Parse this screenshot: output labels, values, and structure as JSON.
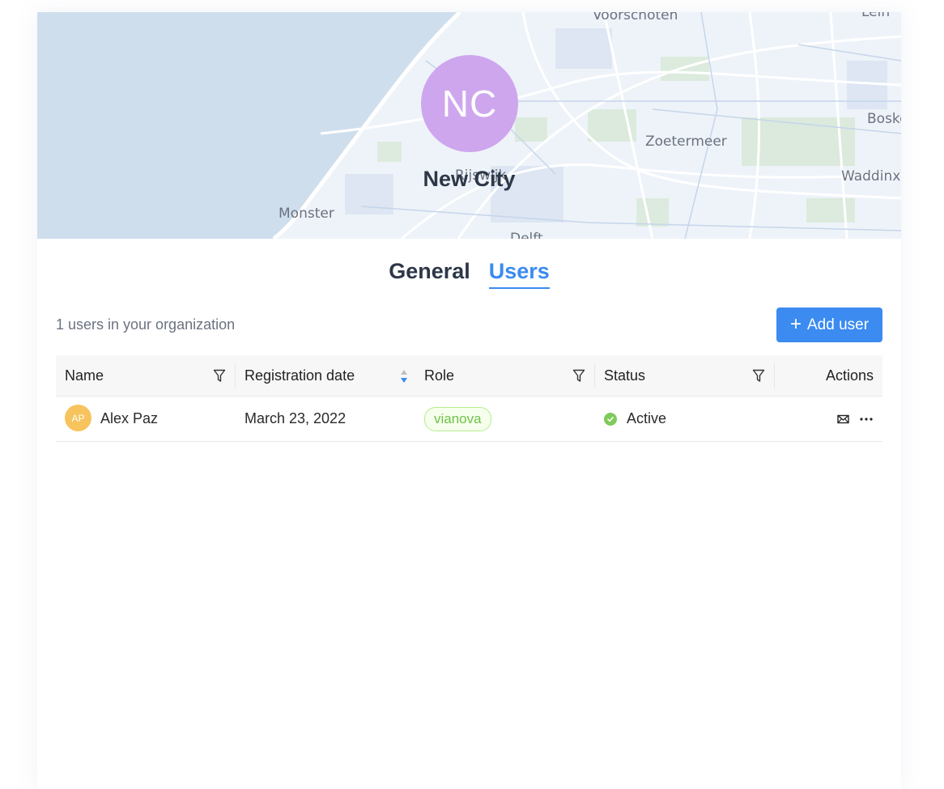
{
  "banner": {
    "initials": "NC",
    "org_name": "New City",
    "map_labels": {
      "top": "Voorschoten",
      "zoetermeer": "Zoetermeer",
      "boskoop": "Bosko",
      "waddinxveen": "Waddinxv",
      "monster": "Monster",
      "rijswijk": "Rijswijk",
      "delft": "Delft",
      "top_right": "Lein"
    },
    "avatar_color": "#cea6ee"
  },
  "tabs": [
    {
      "label": "General",
      "active": false
    },
    {
      "label": "Users",
      "active": true
    }
  ],
  "toolbar": {
    "user_count_text": "1 users in your organization",
    "add_user_label": "Add user",
    "add_user_icon": "plus-icon",
    "accent_color": "#3b8bf0"
  },
  "table": {
    "columns": [
      "Name",
      "Registration date",
      "Role",
      "Status",
      "Actions"
    ],
    "rows": [
      {
        "initials": "AP",
        "name": "Alex Paz",
        "registration_date": "March 23, 2022",
        "role": "vianova",
        "status": "Active",
        "actions": [
          "mail-icon",
          "more-icon"
        ]
      }
    ]
  }
}
